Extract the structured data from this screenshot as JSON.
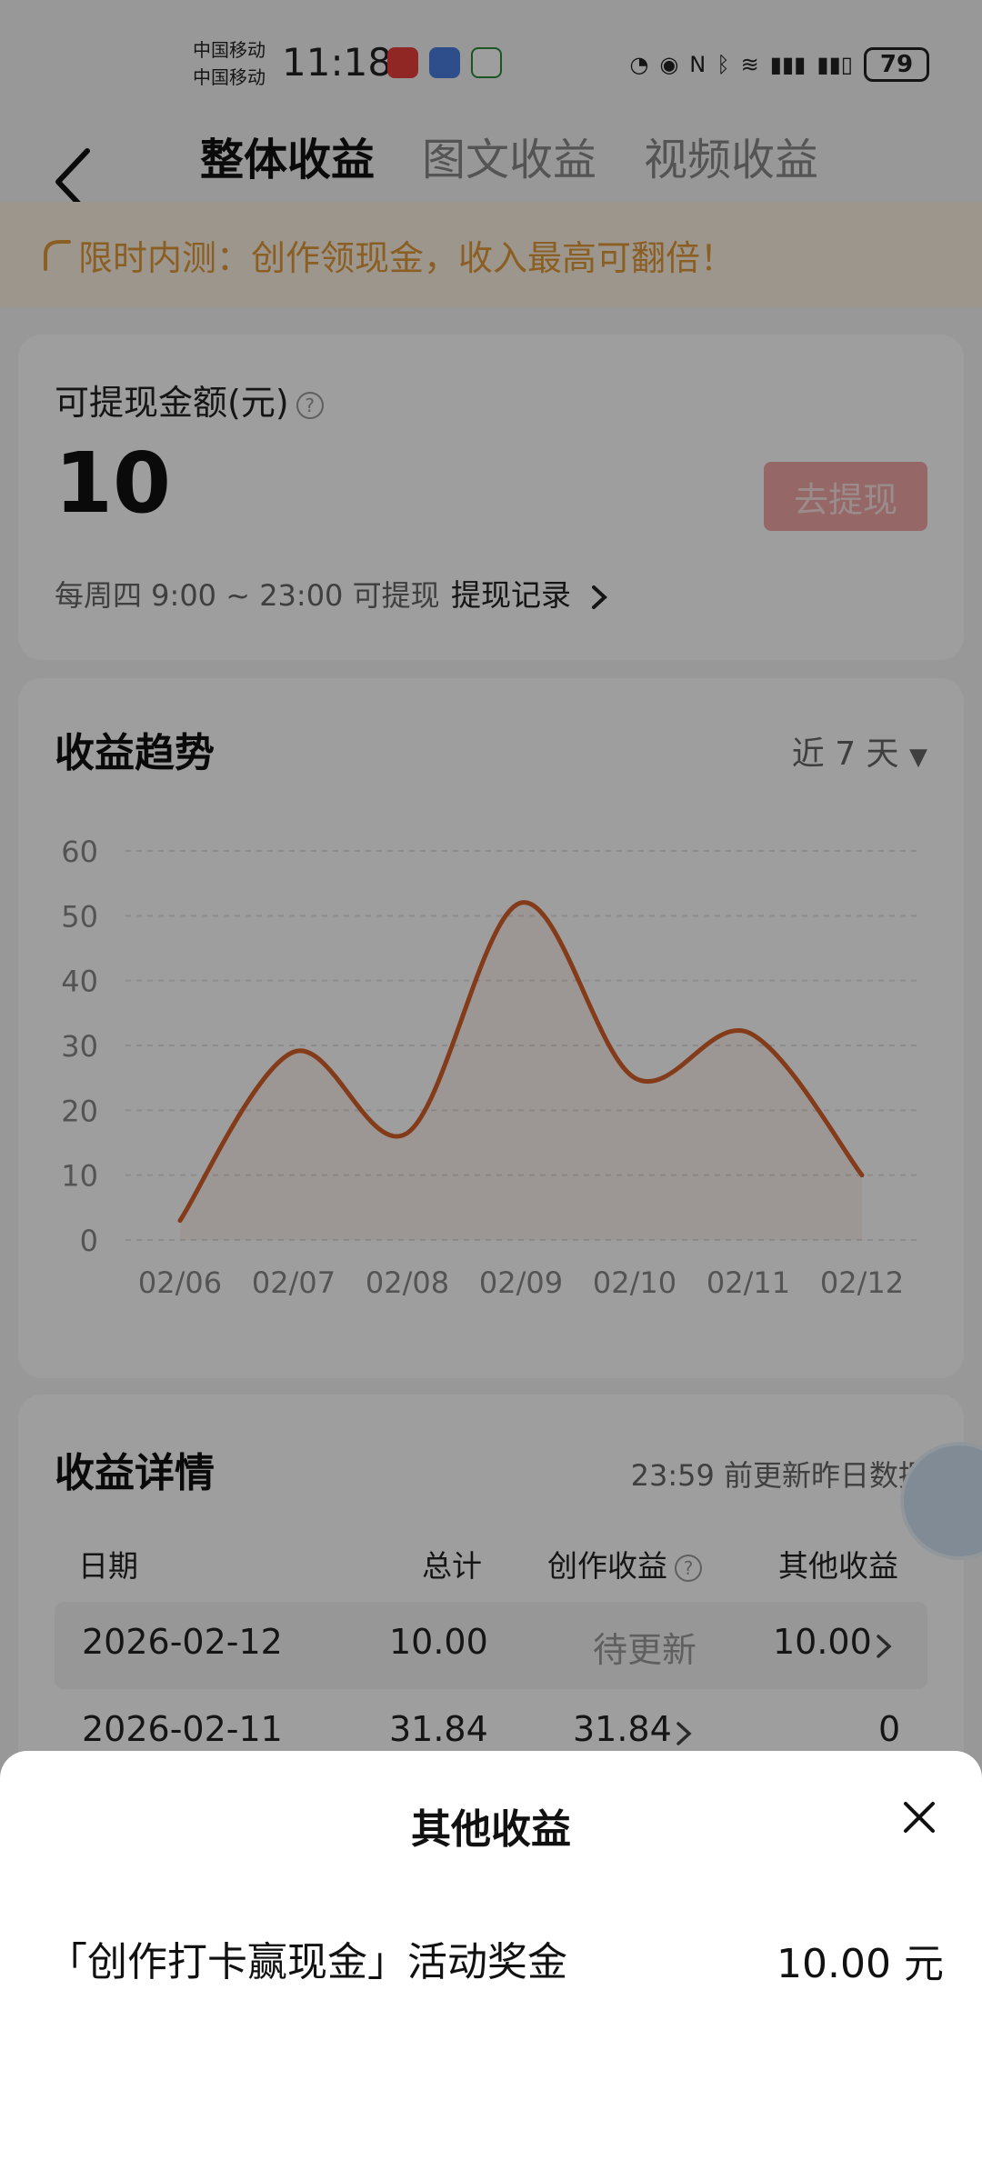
{
  "status_bar": {
    "carrier1": "中国移动",
    "carrier2": "中国移动",
    "time": "11:18",
    "battery": "79"
  },
  "header": {
    "tabs": [
      "整体收益",
      "图文收益",
      "视频收益"
    ]
  },
  "banner": {
    "text": "限时内测：创作领现金，收入最高可翻倍！"
  },
  "withdraw_card": {
    "label": "可提现金额(元)",
    "help": "?",
    "amount": "10",
    "button": "去提现",
    "info": "每周四 9:00 ~ 23:00 可提现",
    "record_link": "提现记录"
  },
  "trend_card": {
    "title": "收益趋势",
    "range": "近 7 天"
  },
  "chart_data": {
    "type": "line",
    "x": [
      "02/06",
      "02/07",
      "02/08",
      "02/09",
      "02/10",
      "02/11",
      "02/12"
    ],
    "values": [
      3,
      29,
      16.5,
      52,
      25,
      32,
      10
    ],
    "yticks": [
      0,
      10,
      20,
      30,
      40,
      50,
      60
    ],
    "ylim": [
      0,
      60
    ],
    "grid": true,
    "color": "#d4602a"
  },
  "detail_card": {
    "title": "收益详情",
    "note": "23:59 前更新昨日数据",
    "headers": {
      "date": "日期",
      "total": "总计",
      "creation": "创作收益",
      "other": "其他收益"
    },
    "rows": [
      {
        "date": "2026-02-12",
        "total": "10.00",
        "creation": "待更新",
        "other": "10.00"
      },
      {
        "date": "2026-02-11",
        "total": "31.84",
        "creation": "31.84",
        "other": "0"
      }
    ]
  },
  "sheet": {
    "title": "其他收益",
    "item_label": "「创作打卡赢现金」活动奖金",
    "item_value": "10.00 元"
  }
}
